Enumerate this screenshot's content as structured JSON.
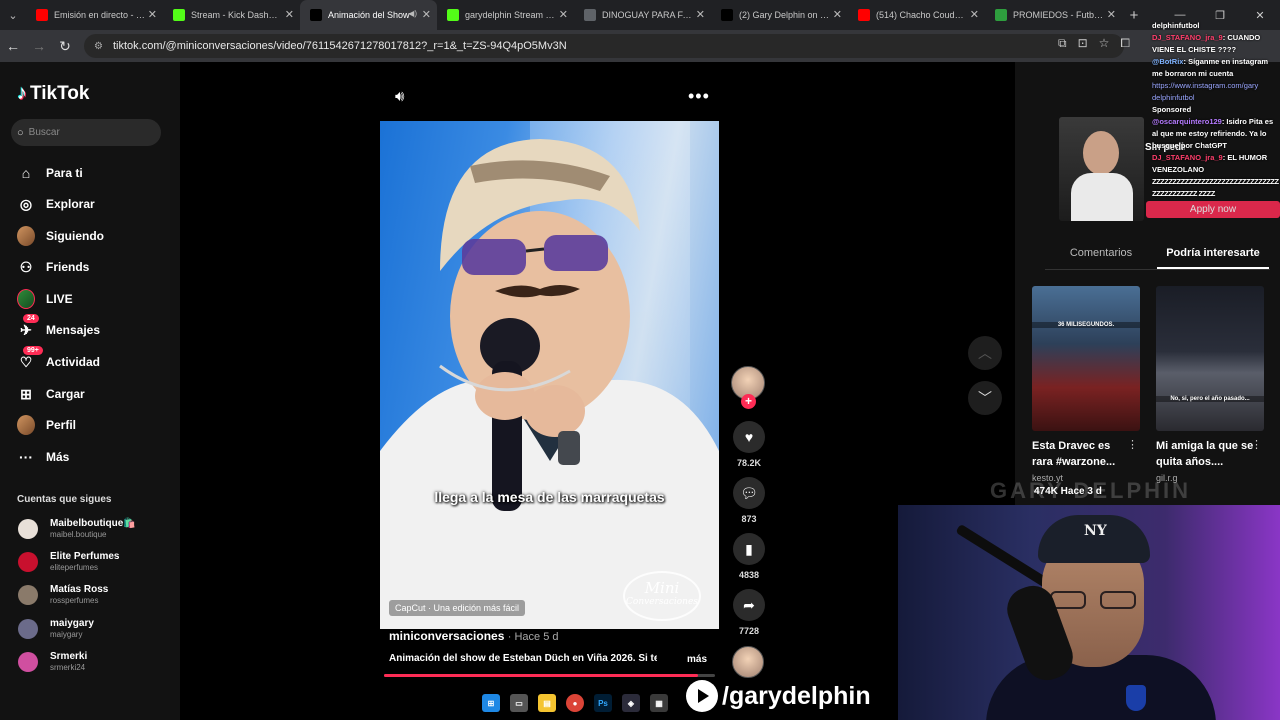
{
  "browser": {
    "tabs": [
      {
        "label": "Emisión en directo - You",
        "color": "#ff0000",
        "active": false
      },
      {
        "label": "Stream - Kick Dashboard",
        "color": "#53fc18",
        "active": false
      },
      {
        "label": "Animación del Show",
        "color": "#000000",
        "active": true
      },
      {
        "label": "garydelphin Stream - W",
        "color": "#53fc18",
        "active": false
      },
      {
        "label": "DINOGUAY PARA FABRI",
        "color": "#5f6368",
        "active": false
      },
      {
        "label": "(2) Gary Delphin on X: \"",
        "color": "#000000",
        "active": false
      },
      {
        "label": "(514) Chacho Coudet / #",
        "color": "#ff0000",
        "active": false
      },
      {
        "label": "PROMIEDOS - Futbol Ar",
        "color": "#2e9e3e",
        "active": false
      }
    ],
    "url": "tiktok.com/@miniconversaciones/video/7611542671278017812?_r=1&_t=ZS-94Q4pO5Mv3N"
  },
  "sidebar": {
    "brand": "TikTok",
    "search_placeholder": "Buscar",
    "menu": [
      {
        "label": "Para ti",
        "icon": "home-icon"
      },
      {
        "label": "Explorar",
        "icon": "compass-icon"
      },
      {
        "label": "Siguiendo",
        "icon": "following-avatar-icon"
      },
      {
        "label": "Friends",
        "icon": "friends-icon"
      },
      {
        "label": "LIVE",
        "icon": "live-icon"
      },
      {
        "label": "Mensajes",
        "icon": "messages-icon",
        "badge": "24"
      },
      {
        "label": "Actividad",
        "icon": "activity-icon",
        "badge": "99+"
      },
      {
        "label": "Cargar",
        "icon": "upload-icon"
      },
      {
        "label": "Perfil",
        "icon": "profile-avatar-icon"
      },
      {
        "label": "Más",
        "icon": "more-icon"
      }
    ],
    "following_title": "Cuentas que sigues",
    "accounts": [
      {
        "name": "Maibelboutique🛍️",
        "handle": "maibel.boutique",
        "color": "#e8e0d8"
      },
      {
        "name": "Elite Perfumes",
        "handle": "eliteperfumes",
        "color": "#c8102e"
      },
      {
        "name": "Matías Ross",
        "handle": "rossperfumes",
        "color": "#8a7a6a"
      },
      {
        "name": "maiygary",
        "handle": "maiygary",
        "color": "#6b6b8a"
      },
      {
        "name": "Srmerki",
        "handle": "srmerki24",
        "color": "#d04fa0"
      }
    ]
  },
  "video": {
    "caption": "llega a la mesa de las marraquetas",
    "capcut_label": "CapCut · Una edición más fácil",
    "watermark_line1": "Mini",
    "watermark_line2": "Conversaciones",
    "author": "miniconversaciones",
    "age": "· Hace 5 d",
    "description": "Animación del show de Esteban Düch en Viña 2026. Si te",
    "more": "más",
    "progress": 0.95
  },
  "actions": {
    "likes": "78.2K",
    "comments": "873",
    "saves": "4838",
    "shares": "7728"
  },
  "right_panel": {
    "ad_text": "Sin pedir",
    "tab_comments": "Comentarios",
    "tab_interest": "Podría interesarte",
    "recs": [
      {
        "title": "Esta Dravec es rara #warzone...",
        "user": "kesto.yt",
        "overlay": "36 MILISEGUNDOS."
      },
      {
        "title": "Mi amiga la que se quita años....",
        "user": "gil.r.g",
        "overlay": "No, si, pero el año pasado..."
      }
    ],
    "rec_stats": "474K   Hace 3 d"
  },
  "chat": [
    {
      "user": "",
      "text": "delphinfutbol",
      "class": ""
    },
    {
      "user": "DJ_STAFANO_jra_9",
      "text": ": CUANDO VIENE EL CHISTE ????",
      "class": "u-red"
    },
    {
      "user": "@BotRix",
      "text": ": Síganme en instagram me borraron mi cuenta",
      "class": "u-blue"
    },
    {
      "user": "",
      "text": "https://www.instagram.com/gary delphinfutbol",
      "class": "link"
    },
    {
      "user": "",
      "text": "Sponsored",
      "class": "sponsored"
    },
    {
      "user": "@oscarquintero129",
      "text": ": Isidro Pita es al que me estoy refiriendo. Ya lo busque por ChatGPT",
      "class": "u-purple"
    },
    {
      "user": "DJ_STAFANO_jra_9",
      "text": ": EL HUMOR VENEZOLANO",
      "class": "u-red"
    },
    {
      "user": "",
      "text": "ZZZZZZZZZZZZZZZZZZZZZZZZZZZZZZZZZZZZZZZZZZ ZZZZ",
      "class": "zz"
    }
  ],
  "apply_label": "Apply now",
  "streamer": {
    "banner": "GARY DELPHIN",
    "handle": "/garydelphin"
  }
}
